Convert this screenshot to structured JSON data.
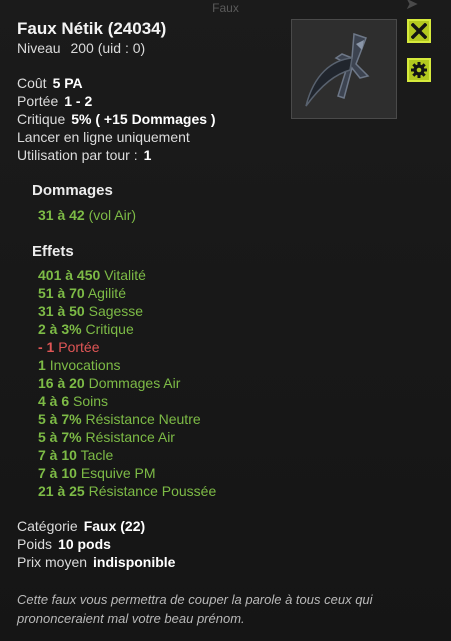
{
  "window": {
    "title": "Faux"
  },
  "item": {
    "name": "Faux Nétik (24034)",
    "level_label": "Niveau",
    "level_value": "200 (uid : 0)",
    "image_alt": "scythe-icon"
  },
  "buttons": {
    "close_icon": "close-icon",
    "settings_icon": "gear-icon"
  },
  "stats": [
    {
      "label": "Coût",
      "value": "5 PA"
    },
    {
      "label": "Portée",
      "value": "1 - 2"
    },
    {
      "label": "Critique",
      "value": "5% ( +15 Dommages )"
    },
    {
      "label": "Lancer en ligne uniquement",
      "value": ""
    },
    {
      "label": "Utilisation par tour :",
      "value": "1"
    }
  ],
  "damage": {
    "title": "Dommages",
    "lines": [
      {
        "num": "31 à 42",
        "text": "(vol Air)"
      }
    ]
  },
  "effects": {
    "title": "Effets",
    "lines": [
      {
        "num": "401 à 450",
        "text": "Vitalité",
        "negative": false
      },
      {
        "num": "51 à 70",
        "text": "Agilité",
        "negative": false
      },
      {
        "num": "31 à 50",
        "text": "Sagesse",
        "negative": false
      },
      {
        "num": "2 à 3%",
        "text": "Critique",
        "negative": false
      },
      {
        "num": "- 1",
        "text": "Portée",
        "negative": true
      },
      {
        "num": "1",
        "text": "Invocations",
        "negative": false
      },
      {
        "num": "16 à 20",
        "text": "Dommages Air",
        "negative": false
      },
      {
        "num": "4 à 6",
        "text": "Soins",
        "negative": false
      },
      {
        "num": "5 à 7%",
        "text": "Résistance Neutre",
        "negative": false
      },
      {
        "num": "5 à 7%",
        "text": "Résistance Air",
        "negative": false
      },
      {
        "num": "7 à 10",
        "text": "Tacle",
        "negative": false
      },
      {
        "num": "7 à 10",
        "text": "Esquive PM",
        "negative": false
      },
      {
        "num": "21 à 25",
        "text": "Résistance Poussée",
        "negative": false
      }
    ]
  },
  "info": [
    {
      "label": "Catégorie",
      "value": "Faux (22)"
    },
    {
      "label": "Poids",
      "value": "10 pods"
    },
    {
      "label": "Prix moyen",
      "value": "indisponible"
    }
  ],
  "description": "Cette faux vous permettra de couper la parole à tous ceux qui prononceraient mal votre beau prénom.",
  "colors": {
    "effect_positive": "#7dbb46",
    "effect_negative": "#e05656",
    "button": "#b3c81f"
  }
}
